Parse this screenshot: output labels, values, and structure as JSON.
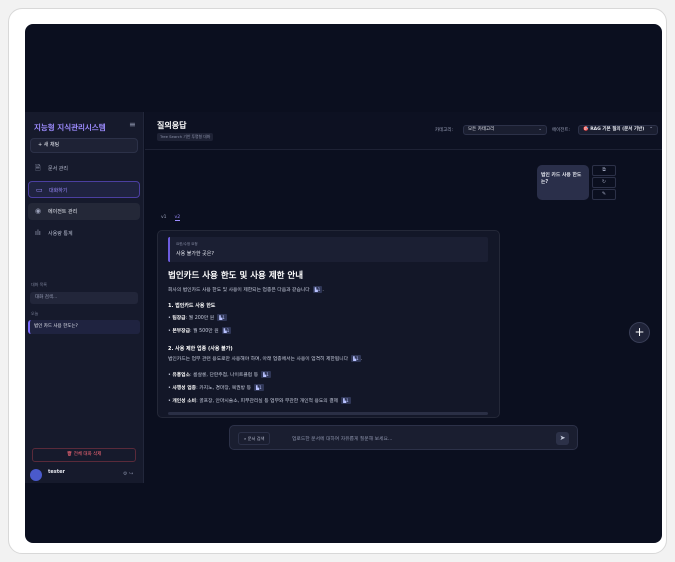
{
  "sidebar": {
    "brand": "지능형 지식관리시스템",
    "menu_icon": "hamburger-icon",
    "new_chat": "새 채팅",
    "nav": [
      {
        "label": "문서 관리",
        "icon": "document-icon"
      },
      {
        "label": "대화하기",
        "icon": "chat-icon"
      },
      {
        "label": "에이전트 관리",
        "icon": "agent-icon"
      },
      {
        "label": "사용량 통계",
        "icon": "chart-icon"
      }
    ],
    "history_label": "대화 목록",
    "search_placeholder": "대화 검색...",
    "today_label": "오늘",
    "conversation": "법인 카드 사용 한도는?",
    "delete_all": "전체 대화 삭제",
    "username": "tester"
  },
  "header": {
    "title": "질의응답",
    "subtitle": "Tree Search 기반 투명형 대화",
    "category_label": "카테고리:",
    "category_value": "모든 카테고리",
    "agent_label": "에이전트:",
    "agent_value": "RAG 기본 질의 (문서 기반)"
  },
  "chat": {
    "user_message": "법인 카드 사용 한도는?",
    "versions": [
      "v1",
      "v2"
    ],
    "quote_label": "요한/수정 요청",
    "quote_text": "사용 불가한 곳은?",
    "answer_title": "법인카드 사용 한도 및 사용 제한 안내",
    "intro": "회사의 법인카드 사용 한도 및 사용이 제한되는 업종은 다음과 같습니다",
    "section1": "1. 법인카드 사용 한도",
    "limit1_bold": "팀장급",
    "limit1_rest": ": 월 200만 원",
    "limit2_bold": "본부장급",
    "limit2_rest": ": 월 500만 원",
    "section2": "2. 사용 제한 업종 (사용 불가)",
    "section2_desc": "법인카드는 업무 관련 용도로만 사용해야 하며, 아래 업종에서는 사용이 엄격히 제한됩니다",
    "r1_bold": "유흥업소",
    "r1_rest": ": 룸살롱, 단란주점, 나이트클럽 등",
    "r2_bold": "사행성 업종",
    "r2_rest": ": 카지노, 경마장, 복권방 등",
    "r3_bold": "개인성 소비",
    "r3_rest": ": 골프장, 안마시술소, 피부관리실 등 업무와 무관한 개인적 용도의 결제",
    "cite": "1",
    "doc_search": "문서 검색",
    "input_placeholder": "업로드한 문서에 대하여 자유롭게 질문해 보세요..."
  }
}
